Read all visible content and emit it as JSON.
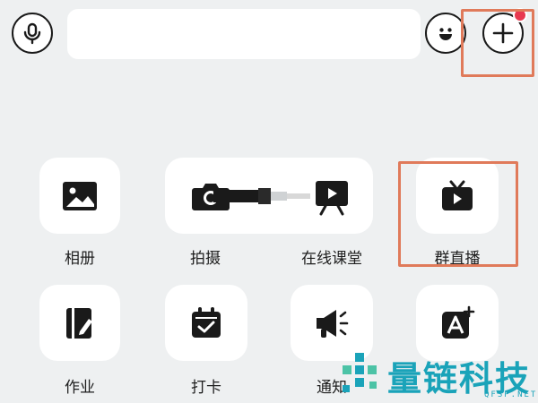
{
  "toolbar": {
    "voice_icon": "microphone-icon",
    "input_value": "",
    "emoji_icon": "smiley-icon",
    "more_icon": "plus-circle-icon"
  },
  "panel": {
    "items": [
      {
        "label": "相册",
        "icon": "image-icon"
      },
      {
        "label": "拍摄",
        "icon": "camera-icon"
      },
      {
        "label": "在线课堂",
        "icon": "easel-play-icon"
      },
      {
        "label": "群直播",
        "icon": "tv-play-icon"
      },
      {
        "label": "作业",
        "icon": "notebook-pencil-icon"
      },
      {
        "label": "打卡",
        "icon": "calendar-check-icon"
      },
      {
        "label": "通知",
        "icon": "megaphone-icon"
      },
      {
        "label": "",
        "icon": "text-add-icon"
      }
    ]
  },
  "watermark": {
    "name": "量链科技",
    "domain": "QFSP.NET"
  },
  "colors": {
    "background": "#eef0f1",
    "tile": "#ffffff",
    "icon": "#1a1a1a",
    "highlight": "#e07a5a",
    "badge": "#e8384f",
    "watermark": "#1aa3b9"
  }
}
